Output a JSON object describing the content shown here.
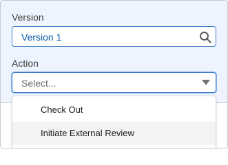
{
  "version_field": {
    "label": "Version",
    "value": "Version 1",
    "icon": "search-icon"
  },
  "action_field": {
    "label": "Action",
    "placeholder": "Select...",
    "icon": "chevron-down-icon"
  },
  "action_menu": {
    "items": [
      {
        "label": "Check Out"
      },
      {
        "label": "Initiate External Review",
        "highlighted": true
      }
    ]
  },
  "colors": {
    "panel_background": "#eef4ff",
    "focus_border": "#3d7bc9",
    "value_text": "#0b5cab",
    "highlight_row": "#f3f3f3"
  }
}
